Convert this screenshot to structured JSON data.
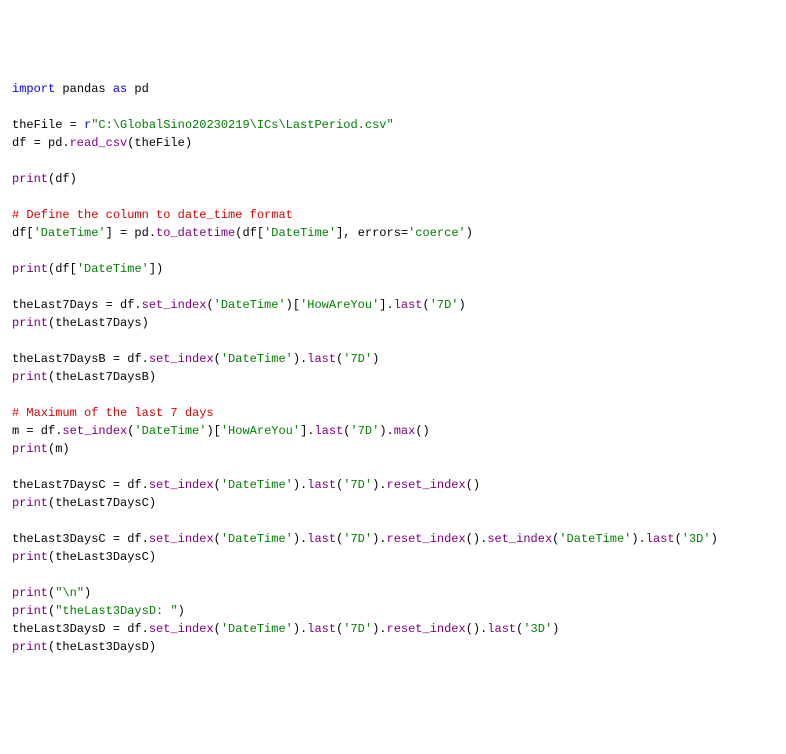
{
  "lines": [
    {
      "tokens": [
        {
          "cls": "kw",
          "t": "import"
        },
        {
          "cls": "text",
          "t": " pandas "
        },
        {
          "cls": "kw",
          "t": "as"
        },
        {
          "cls": "text",
          "t": " pd"
        }
      ]
    },
    {
      "tokens": []
    },
    {
      "tokens": [
        {
          "cls": "text",
          "t": "theFile = "
        },
        {
          "cls": "raw",
          "t": "r"
        },
        {
          "cls": "str",
          "t": "\"C:\\GlobalSino20230219\\ICs\\LastPeriod.csv\""
        }
      ]
    },
    {
      "tokens": [
        {
          "cls": "text",
          "t": "df = pd."
        },
        {
          "cls": "fn",
          "t": "read_csv"
        },
        {
          "cls": "text",
          "t": "(theFile)"
        }
      ]
    },
    {
      "tokens": []
    },
    {
      "tokens": [
        {
          "cls": "fn",
          "t": "print"
        },
        {
          "cls": "text",
          "t": "(df)"
        }
      ]
    },
    {
      "tokens": []
    },
    {
      "tokens": [
        {
          "cls": "comment",
          "t": "# Define the column to date_time format"
        }
      ]
    },
    {
      "tokens": [
        {
          "cls": "text",
          "t": "df["
        },
        {
          "cls": "str",
          "t": "'DateTime'"
        },
        {
          "cls": "text",
          "t": "] = pd."
        },
        {
          "cls": "fn",
          "t": "to_datetime"
        },
        {
          "cls": "text",
          "t": "(df["
        },
        {
          "cls": "str",
          "t": "'DateTime'"
        },
        {
          "cls": "text",
          "t": "], errors="
        },
        {
          "cls": "str",
          "t": "'coerce'"
        },
        {
          "cls": "text",
          "t": ")"
        }
      ]
    },
    {
      "tokens": []
    },
    {
      "tokens": [
        {
          "cls": "fn",
          "t": "print"
        },
        {
          "cls": "text",
          "t": "(df["
        },
        {
          "cls": "str",
          "t": "'DateTime'"
        },
        {
          "cls": "text",
          "t": "])"
        }
      ]
    },
    {
      "tokens": []
    },
    {
      "tokens": [
        {
          "cls": "text",
          "t": "theLast7Days = df."
        },
        {
          "cls": "fn",
          "t": "set_index"
        },
        {
          "cls": "text",
          "t": "("
        },
        {
          "cls": "str",
          "t": "'DateTime'"
        },
        {
          "cls": "text",
          "t": ")["
        },
        {
          "cls": "str",
          "t": "'HowAreYou'"
        },
        {
          "cls": "text",
          "t": "]."
        },
        {
          "cls": "fn",
          "t": "last"
        },
        {
          "cls": "text",
          "t": "("
        },
        {
          "cls": "str",
          "t": "'7D'"
        },
        {
          "cls": "text",
          "t": ")"
        }
      ]
    },
    {
      "tokens": [
        {
          "cls": "fn",
          "t": "print"
        },
        {
          "cls": "text",
          "t": "(theLast7Days)"
        }
      ]
    },
    {
      "tokens": []
    },
    {
      "tokens": [
        {
          "cls": "text",
          "t": "theLast7DaysB = df."
        },
        {
          "cls": "fn",
          "t": "set_index"
        },
        {
          "cls": "text",
          "t": "("
        },
        {
          "cls": "str",
          "t": "'DateTime'"
        },
        {
          "cls": "text",
          "t": ")."
        },
        {
          "cls": "fn",
          "t": "last"
        },
        {
          "cls": "text",
          "t": "("
        },
        {
          "cls": "str",
          "t": "'7D'"
        },
        {
          "cls": "text",
          "t": ")"
        }
      ]
    },
    {
      "tokens": [
        {
          "cls": "fn",
          "t": "print"
        },
        {
          "cls": "text",
          "t": "(theLast7DaysB)"
        }
      ]
    },
    {
      "tokens": []
    },
    {
      "tokens": [
        {
          "cls": "comment",
          "t": "# Maximum of the last 7 days"
        }
      ]
    },
    {
      "tokens": [
        {
          "cls": "text",
          "t": "m = df."
        },
        {
          "cls": "fn",
          "t": "set_index"
        },
        {
          "cls": "text",
          "t": "("
        },
        {
          "cls": "str",
          "t": "'DateTime'"
        },
        {
          "cls": "text",
          "t": ")["
        },
        {
          "cls": "str",
          "t": "'HowAreYou'"
        },
        {
          "cls": "text",
          "t": "]."
        },
        {
          "cls": "fn",
          "t": "last"
        },
        {
          "cls": "text",
          "t": "("
        },
        {
          "cls": "str",
          "t": "'7D'"
        },
        {
          "cls": "text",
          "t": ")."
        },
        {
          "cls": "fn",
          "t": "max"
        },
        {
          "cls": "text",
          "t": "()"
        }
      ]
    },
    {
      "tokens": [
        {
          "cls": "fn",
          "t": "print"
        },
        {
          "cls": "text",
          "t": "(m)"
        }
      ]
    },
    {
      "tokens": []
    },
    {
      "tokens": [
        {
          "cls": "text",
          "t": "theLast7DaysC = df."
        },
        {
          "cls": "fn",
          "t": "set_index"
        },
        {
          "cls": "text",
          "t": "("
        },
        {
          "cls": "str",
          "t": "'DateTime'"
        },
        {
          "cls": "text",
          "t": ")."
        },
        {
          "cls": "fn",
          "t": "last"
        },
        {
          "cls": "text",
          "t": "("
        },
        {
          "cls": "str",
          "t": "'7D'"
        },
        {
          "cls": "text",
          "t": ")."
        },
        {
          "cls": "fn",
          "t": "reset_index"
        },
        {
          "cls": "text",
          "t": "()"
        }
      ]
    },
    {
      "tokens": [
        {
          "cls": "fn",
          "t": "print"
        },
        {
          "cls": "text",
          "t": "(theLast7DaysC)"
        }
      ]
    },
    {
      "tokens": []
    },
    {
      "tokens": [
        {
          "cls": "text",
          "t": "theLast3DaysC = df."
        },
        {
          "cls": "fn",
          "t": "set_index"
        },
        {
          "cls": "text",
          "t": "("
        },
        {
          "cls": "str",
          "t": "'DateTime'"
        },
        {
          "cls": "text",
          "t": ")."
        },
        {
          "cls": "fn",
          "t": "last"
        },
        {
          "cls": "text",
          "t": "("
        },
        {
          "cls": "str",
          "t": "'7D'"
        },
        {
          "cls": "text",
          "t": ")."
        },
        {
          "cls": "fn",
          "t": "reset_index"
        },
        {
          "cls": "text",
          "t": "()."
        },
        {
          "cls": "fn",
          "t": "set_index"
        },
        {
          "cls": "text",
          "t": "("
        },
        {
          "cls": "str",
          "t": "'DateTime'"
        },
        {
          "cls": "text",
          "t": ")."
        },
        {
          "cls": "fn",
          "t": "last"
        },
        {
          "cls": "text",
          "t": "("
        },
        {
          "cls": "str",
          "t": "'3D'"
        },
        {
          "cls": "text",
          "t": ")"
        }
      ]
    },
    {
      "tokens": [
        {
          "cls": "fn",
          "t": "print"
        },
        {
          "cls": "text",
          "t": "(theLast3DaysC)"
        }
      ]
    },
    {
      "tokens": []
    },
    {
      "tokens": [
        {
          "cls": "fn",
          "t": "print"
        },
        {
          "cls": "text",
          "t": "("
        },
        {
          "cls": "str",
          "t": "\"\\n\""
        },
        {
          "cls": "text",
          "t": ")"
        }
      ]
    },
    {
      "tokens": [
        {
          "cls": "fn",
          "t": "print"
        },
        {
          "cls": "text",
          "t": "("
        },
        {
          "cls": "str",
          "t": "\"theLast3DaysD: \""
        },
        {
          "cls": "text",
          "t": ")"
        }
      ]
    },
    {
      "tokens": [
        {
          "cls": "text",
          "t": "theLast3DaysD = df."
        },
        {
          "cls": "fn",
          "t": "set_index"
        },
        {
          "cls": "text",
          "t": "("
        },
        {
          "cls": "str",
          "t": "'DateTime'"
        },
        {
          "cls": "text",
          "t": ")."
        },
        {
          "cls": "fn",
          "t": "last"
        },
        {
          "cls": "text",
          "t": "("
        },
        {
          "cls": "str",
          "t": "'7D'"
        },
        {
          "cls": "text",
          "t": ")."
        },
        {
          "cls": "fn",
          "t": "reset_index"
        },
        {
          "cls": "text",
          "t": "()."
        },
        {
          "cls": "fn",
          "t": "last"
        },
        {
          "cls": "text",
          "t": "("
        },
        {
          "cls": "str",
          "t": "'3D'"
        },
        {
          "cls": "text",
          "t": ")"
        }
      ]
    },
    {
      "tokens": [
        {
          "cls": "fn",
          "t": "print"
        },
        {
          "cls": "text",
          "t": "(theLast3DaysD)"
        }
      ]
    }
  ]
}
